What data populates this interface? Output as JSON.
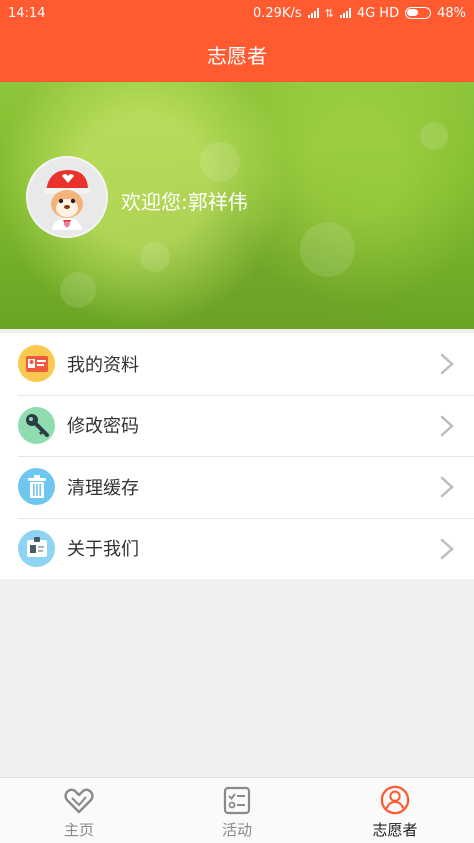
{
  "status_bar": {
    "time": "14:14",
    "speed": "0.29K/s",
    "network": "4G HD",
    "battery": "48%"
  },
  "header": {
    "title": "志愿者"
  },
  "profile": {
    "welcome_prefix": "欢迎您:",
    "user_name": "郭祥伟"
  },
  "menu": {
    "items": [
      {
        "label": "我的资料",
        "icon": "profile-card-icon",
        "color": "#f8c94e"
      },
      {
        "label": "修改密码",
        "icon": "key-icon",
        "color": "#8fdcb1"
      },
      {
        "label": "清理缓存",
        "icon": "trash-icon",
        "color": "#6ec7ef"
      },
      {
        "label": "关于我们",
        "icon": "id-badge-icon",
        "color": "#8dd3f2"
      }
    ]
  },
  "tabbar": {
    "tabs": [
      {
        "label": "主页",
        "icon": "heart-hands-icon"
      },
      {
        "label": "活动",
        "icon": "checklist-icon"
      },
      {
        "label": "志愿者",
        "icon": "user-circle-icon",
        "active": true
      }
    ]
  },
  "colors": {
    "brand": "#ff5a30",
    "active_tab": "#ff5a30"
  }
}
